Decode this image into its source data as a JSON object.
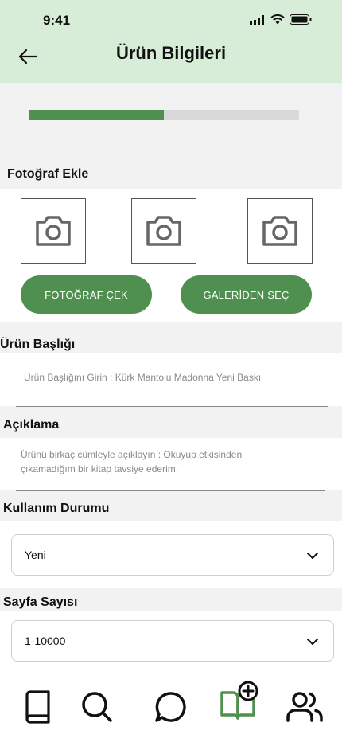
{
  "status_bar": {
    "time": "9:41"
  },
  "header": {
    "title": "Ürün Bilgileri"
  },
  "progress": {
    "value": 0.5
  },
  "photos": {
    "section_label": "Fotoğraf Ekle",
    "slot_icon": "camera-icon",
    "take_photo_label": "FOTOĞRAF ÇEK",
    "gallery_label": "GALERİDEN SEÇ"
  },
  "title_field": {
    "label": "Ürün Başlığı",
    "placeholder": "Ürün Başlığını Girin : Kürk Mantolu Madonna Yeni Baskı"
  },
  "description_field": {
    "label": "Açıklama",
    "placeholder_line1": "Ürünü birkaç cümleyle açıklayın : Okuyup etkisinden",
    "placeholder_line2": "çıkamadığım bir kitap tavsiye ederim."
  },
  "condition_field": {
    "label": "Kullanım Durumu",
    "value": "Yeni"
  },
  "page_count_field": {
    "label": "Sayfa Sayısı",
    "value": "1-10000"
  },
  "tabbar": {
    "items": [
      "book-icon",
      "search-icon",
      "chat-icon",
      "add-book-icon",
      "users-icon"
    ],
    "active": "add-book-icon",
    "active_color": "#4f8f4f"
  },
  "colors": {
    "accent": "#4f8f4f",
    "header_bg": "#d8edd8"
  }
}
